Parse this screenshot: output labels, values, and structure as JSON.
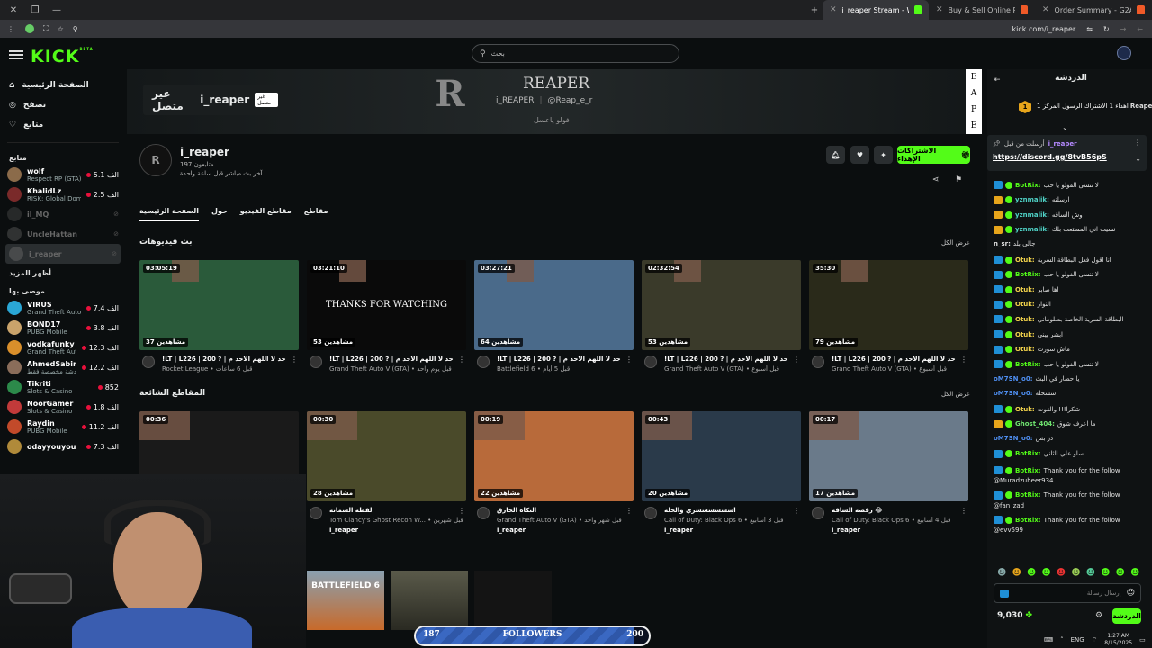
{
  "browser": {
    "tabs": [
      {
        "title": "i_reaper Stream - Watch Live o",
        "active": true
      },
      {
        "title": "Buy & Sell Online PC Games, S",
        "active": false
      },
      {
        "title": "Order Summary - G2A.COM",
        "active": false
      }
    ],
    "url": "kick.com/i_reaper"
  },
  "kick": {
    "logo": "KICK",
    "logo_badge": "BETA",
    "search_placeholder": "بحث",
    "nav": [
      {
        "label": "الصفحة الرئيسية",
        "icon": "home-icon"
      },
      {
        "label": "تصفح",
        "icon": "compass-icon"
      },
      {
        "label": "متابع",
        "icon": "heart-icon"
      }
    ],
    "following_header": "متابع",
    "following": [
      {
        "name": "wolf",
        "game": "Respect RP (GTA)",
        "count": "5.1 الف",
        "live": true,
        "color": "#8b6b4a"
      },
      {
        "name": "KhalidLz",
        "game": "RISK: Global Domin...",
        "count": "2.5 الف",
        "live": true,
        "color": "#7a2a2a"
      },
      {
        "name": "il_MQ",
        "game": "",
        "count": "",
        "live": false,
        "color": "#444"
      },
      {
        "name": "UncleHattan",
        "game": "",
        "count": "",
        "live": false,
        "color": "#555"
      },
      {
        "name": "i_reaper",
        "game": "",
        "count": "",
        "live": false,
        "color": "#666"
      }
    ],
    "show_more": "أظهر المزيد",
    "recommended_header": "موصى بها",
    "recommended": [
      {
        "name": "VIRUS",
        "game": "Grand Theft Auto V...",
        "count": "7.4 الف",
        "color": "#2aa7d6"
      },
      {
        "name": "BOND17",
        "game": "PUBG Mobile",
        "count": "3.8 الف",
        "color": "#c9a36b"
      },
      {
        "name": "vodkafunky",
        "game": "Grand Theft Auto ...",
        "count": "12.3 الف",
        "color": "#d98f2b"
      },
      {
        "name": "AhmedSabiri",
        "game": "دردشة مخصصة فقط",
        "count": "12.2 الف",
        "color": "#8a6d5a"
      },
      {
        "name": "Tikriti",
        "game": "Slots & Casino",
        "count": "852",
        "color": "#2c8a4a"
      },
      {
        "name": "NoorGamer",
        "game": "Slots & Casino",
        "count": "1.8 الف",
        "color": "#c23a3a"
      },
      {
        "name": "Raydin",
        "game": "PUBG Mobile",
        "count": "11.2 الف",
        "color": "#c24a2a"
      },
      {
        "name": "odayyouyou",
        "game": "",
        "count": "7.3 الف",
        "color": "#b08a3a"
      }
    ]
  },
  "channel": {
    "offline_text": "غير متصل",
    "offline_name": "i_reaper",
    "offline_tag": "غير متصل",
    "banner_name": "REAPER",
    "banner_handle1": "i_REAPER",
    "banner_handle2": "@Reap_e_r",
    "banner_follow": "فولو ياعسل",
    "side_letters": [
      "E",
      "A",
      "P",
      "E"
    ],
    "username": "i_reaper",
    "followers": "197 متابعون",
    "last_live": "آخر بث مباشر قبل ساعة واحدة",
    "gift_button": "الاشتراكات الإهداء",
    "tabs": [
      "الصفحة الرئيسية",
      "حول",
      "مقاطع الفيديو",
      "مقاطع"
    ],
    "past_streams_header": "بث فيديوهات",
    "view_all": "عرض الكل",
    "popular_clips_header": "المقاطع الشائعة"
  },
  "streams": [
    {
      "duration": "03:05:19",
      "views": "37 مشاهدين",
      "title": "!LT | L226 | 200 ? | حد لا اللهم الاحد م",
      "sub": "Rocket League • قبل 6 ساعات",
      "bg": "#2a5a3a"
    },
    {
      "duration": "03:21:10",
      "views": "53 مشاهدين",
      "title": "!LT | L226 | 200 ? | حد لا اللهم الاحد م",
      "sub": "Grand Theft Auto V (GTA) • قبل يوم واحد",
      "bg": "#0a0a0a"
    },
    {
      "duration": "03:27:21",
      "views": "64 مشاهدين",
      "title": "!LT | L226 | 200 ? | حد لا اللهم الاحد م",
      "sub": "Battlefield 6 • قبل 5 أيام",
      "bg": "#4a6a8a"
    },
    {
      "duration": "02:32:54",
      "views": "53 مشاهدين",
      "title": "!LT | L226 | 200 ? | حد لا اللهم الاحد م",
      "sub": "Grand Theft Auto V (GTA) • قبل أسبوع",
      "bg": "#3a3a2a"
    },
    {
      "duration": "35:30",
      "views": "79 مشاهدين",
      "title": "!LT | L226 | 200 ? | حد لا اللهم الاحد م",
      "sub": "Grand Theft Auto V (GTA) • قبل أسبوع",
      "bg": "#2a2a1a"
    }
  ],
  "stream_thumb_text": "THANKS FOR WATCHING",
  "clips": [
    {
      "duration": "00:36",
      "views": "",
      "title": "",
      "sub": "",
      "author": "",
      "bg": "#1a1a1a"
    },
    {
      "duration": "00:30",
      "views": "28 مشاهدين",
      "title": "لقطة الشماتة",
      "sub": "Tom Clancy's Ghost Recon W... • قبل شهرين",
      "author": "i_reaper",
      "bg": "#4a4a2a"
    },
    {
      "duration": "00:19",
      "views": "22 مشاهدين",
      "title": "التكاه الخارق",
      "sub": "Grand Theft Auto V (GTA) • قبل شهر واحد",
      "author": "i_reaper",
      "bg": "#b86a3a"
    },
    {
      "duration": "00:43",
      "views": "20 مشاهدين",
      "title": "اسسسسسسري والحلة",
      "sub": "Call of Duty: Black Ops 6 • قبل 3 أسابيع",
      "author": "i_reaper",
      "bg": "#2a3a4a"
    },
    {
      "duration": "00:17",
      "views": "17 مشاهدين",
      "title": "رقصة الساقة 😂",
      "sub": "Call of Duty: Black Ops 6 • قبل 4 أسابيع",
      "author": "i_reaper",
      "bg": "#6a7a8a"
    }
  ],
  "bottom_thumb_text": "BATTLEFIELD 6",
  "followers_bar": {
    "current": "187",
    "label": "FOLLOWERS",
    "goal": "200",
    "progress": 0.935
  },
  "chat": {
    "header": "الدردشة",
    "gift_line": "اهداء 1 الاشتراك الرسول المركز 1",
    "gift_user": "Reaper",
    "pinned_by": "أرسلت من قبل",
    "pinned_user": "i_reaper",
    "pinned_link": "https://discord.gg/8tvB56pS",
    "messages": [
      {
        "user": "BotRix:",
        "text": "لا تنسى الفولو يا حب",
        "color": "#53fc18",
        "badge": "b-blue"
      },
      {
        "user": "yznmalik:",
        "text": "ارسلته",
        "color": "#4fd2c6",
        "badge": "b-gold"
      },
      {
        "user": "yznmalik:",
        "text": "وش الساقه",
        "color": "#4fd2c6",
        "badge": "b-gold"
      },
      {
        "user": "yznmalik:",
        "text": "نسيت اني المستعت بلك",
        "color": "#4fd2c6",
        "badge": "b-gold"
      },
      {
        "user": "n_sr:",
        "text": "جالي بلد",
        "color": "#e0e0e0",
        "badge": ""
      },
      {
        "user": "Otuk:",
        "text": "انا اقول فعل البطاقة السرية",
        "color": "#f2d34c",
        "badge": "b-blue"
      },
      {
        "user": "BotRix:",
        "text": "لا تنسى الفولو يا حب",
        "color": "#53fc18",
        "badge": "b-blue"
      },
      {
        "user": "Otuk:",
        "text": "اها صابر",
        "color": "#f2d34c",
        "badge": "b-blue"
      },
      {
        "user": "Otuk:",
        "text": "النوار",
        "color": "#f2d34c",
        "badge": "b-blue"
      },
      {
        "user": "Otuk:",
        "text": "البطاقة السرية الخاصة بصلوماني",
        "color": "#f2d34c",
        "badge": "b-blue"
      },
      {
        "user": "Otuk:",
        "text": "ابشر بيني",
        "color": "#f2d34c",
        "badge": "b-blue"
      },
      {
        "user": "Otuk:",
        "text": "ماش سورت",
        "color": "#f2d34c",
        "badge": "b-blue"
      },
      {
        "user": "BotRix:",
        "text": "لا تنسى الفولو يا حب",
        "color": "#53fc18",
        "badge": "b-blue"
      },
      {
        "user": "oM7SN_o0:",
        "text": "يا حصار في البث",
        "color": "#4f8ff2",
        "badge": ""
      },
      {
        "user": "oM7SN_o0:",
        "text": "شسخلة",
        "color": "#4f8ff2",
        "badge": ""
      },
      {
        "user": "Otuk:",
        "text": "شكرا!!! والقوت",
        "color": "#f2d34c",
        "badge": "b-blue"
      },
      {
        "user": "Ghost_404:",
        "text": "ما اعرف شوق",
        "color": "#6fe36f",
        "badge": "b-gold"
      },
      {
        "user": "oM7SN_o0:",
        "text": "دز بس",
        "color": "#4f8ff2",
        "badge": ""
      },
      {
        "user": "BotRix:",
        "text": "ساو علي الثاني",
        "color": "#53fc18",
        "badge": "b-blue"
      }
    ],
    "follow_msgs": [
      {
        "user": "BotRix:",
        "text": "Thank you for the follow",
        "target": "@Muradzuheer934"
      },
      {
        "user": "BotRix:",
        "text": "Thank you for the follow",
        "target": "@fan_zad"
      },
      {
        "user": "BotRix:",
        "text": "Thank you for the follow",
        "target": "@evv599"
      }
    ],
    "input_placeholder": "إرسال رسالة",
    "points": "9,030",
    "send_label": "الدردشة"
  },
  "taskbar": {
    "lang": "ENG",
    "time": "1:27 AM",
    "date": "8/15/2025"
  }
}
